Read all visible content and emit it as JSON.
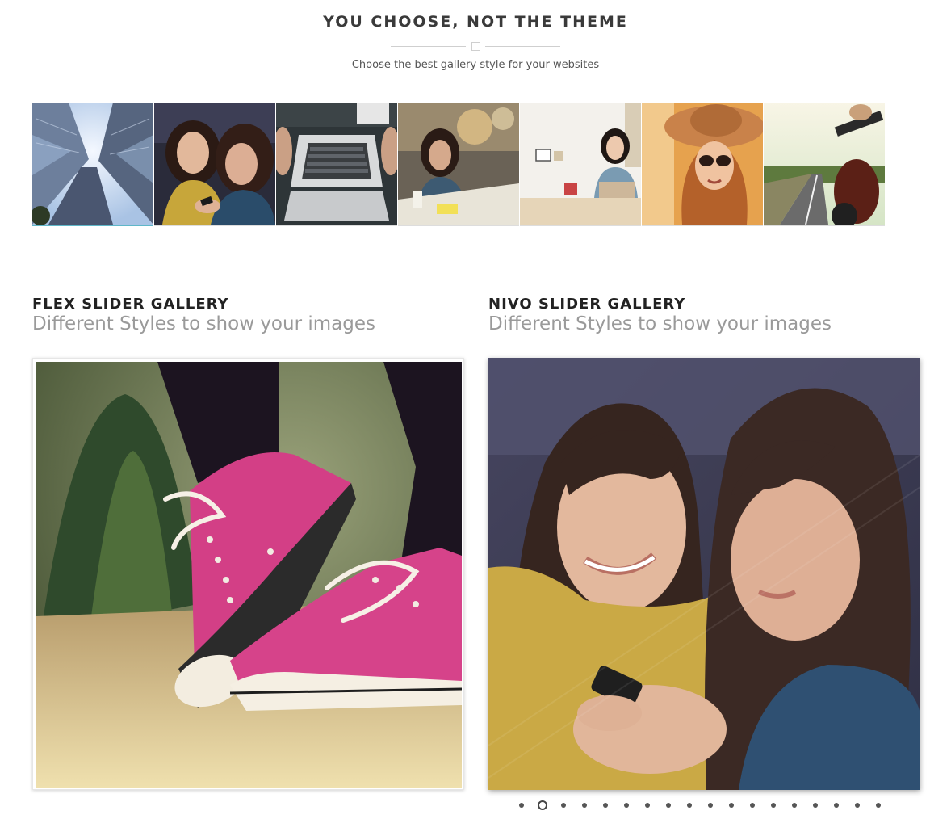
{
  "header": {
    "title": "YOU CHOOSE, NOT THE THEME",
    "subtitle": "Choose the best gallery style for your websites"
  },
  "thumbnails": [
    {
      "name": "skyscrapers",
      "active": true
    },
    {
      "name": "two-women-phone",
      "active": false
    },
    {
      "name": "laptop-desk",
      "active": false
    },
    {
      "name": "woman-cafe",
      "active": false
    },
    {
      "name": "woman-laptop-office",
      "active": false
    },
    {
      "name": "woman-hat-sunglasses",
      "active": false
    },
    {
      "name": "motorcycle-road",
      "active": false
    }
  ],
  "flex_gallery": {
    "title": "FLEX SLIDER GALLERY",
    "subtitle": "Different Styles to show your images"
  },
  "nivo_gallery": {
    "title": "NIVO SLIDER GALLERY",
    "subtitle": "Different Styles to show your images",
    "dots_count": 18,
    "active_dot_index": 1
  },
  "colors": {
    "accent": "#5fb7c9",
    "title": "#3a3a3a",
    "subtitle_gray": "#9a9a9a"
  }
}
